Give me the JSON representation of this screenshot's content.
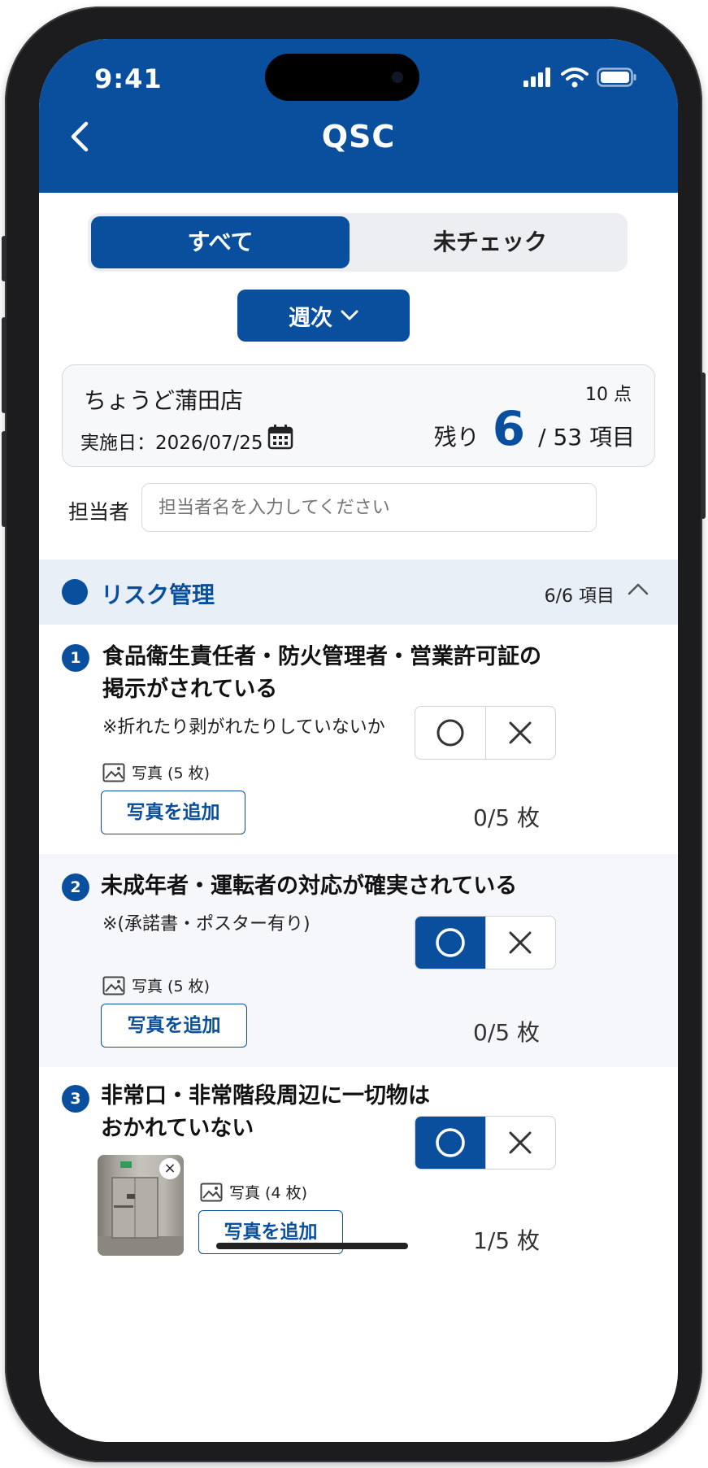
{
  "status": {
    "time": "9:41"
  },
  "header": {
    "title": "QSC"
  },
  "tabs": {
    "all": "すべて",
    "unchecked": "未チェック"
  },
  "period": {
    "selected": "週次"
  },
  "store": {
    "name": "ちょうど蒲田店",
    "date_label": "実施日：2026/07/25",
    "points": "10 点",
    "remaining_label": "残り",
    "remaining_count": "6",
    "total": "/ 53 項目"
  },
  "assignee": {
    "label": "担当者",
    "placeholder": "担当者名を入力してください"
  },
  "section": {
    "title": "リスク管理",
    "count": "6/6 項目"
  },
  "items": [
    {
      "number": "1",
      "line1": "食品衛生責任者・防火管理者・営業許可証の",
      "line2": "掲示がされている",
      "note": "※折れたり剥がれたりしていないか",
      "photo_label": "写真 (5 枚)",
      "add_photo": "写真を追加",
      "photo_count": "0/5 枚",
      "selected": "none"
    },
    {
      "number": "2",
      "line1": "未成年者・運転者の対応が確実されている",
      "note": "※(承諾書・ポスター有り)",
      "photo_label": "写真 (5 枚)",
      "add_photo": "写真を追加",
      "photo_count": "0/5 枚",
      "selected": "O"
    },
    {
      "number": "3",
      "line1": "非常口・非常階段周辺に一切物は",
      "line2": "おかれていない",
      "photo_label": "写真 (4 枚)",
      "add_photo": "写真を追加",
      "photo_count": "1/5 枚",
      "selected": "O"
    }
  ],
  "colors": {
    "brand": "#0a4f9e",
    "section_bg": "#e9eff7",
    "alt_row_bg": "#f5f7fa"
  },
  "icons": [
    "back-chevron-icon",
    "chevron-down-icon",
    "calendar-icon",
    "chevron-up-icon",
    "image-icon",
    "circle-icon",
    "cross-icon",
    "close-icon",
    "signal-icon",
    "wifi-icon",
    "battery-icon"
  ]
}
